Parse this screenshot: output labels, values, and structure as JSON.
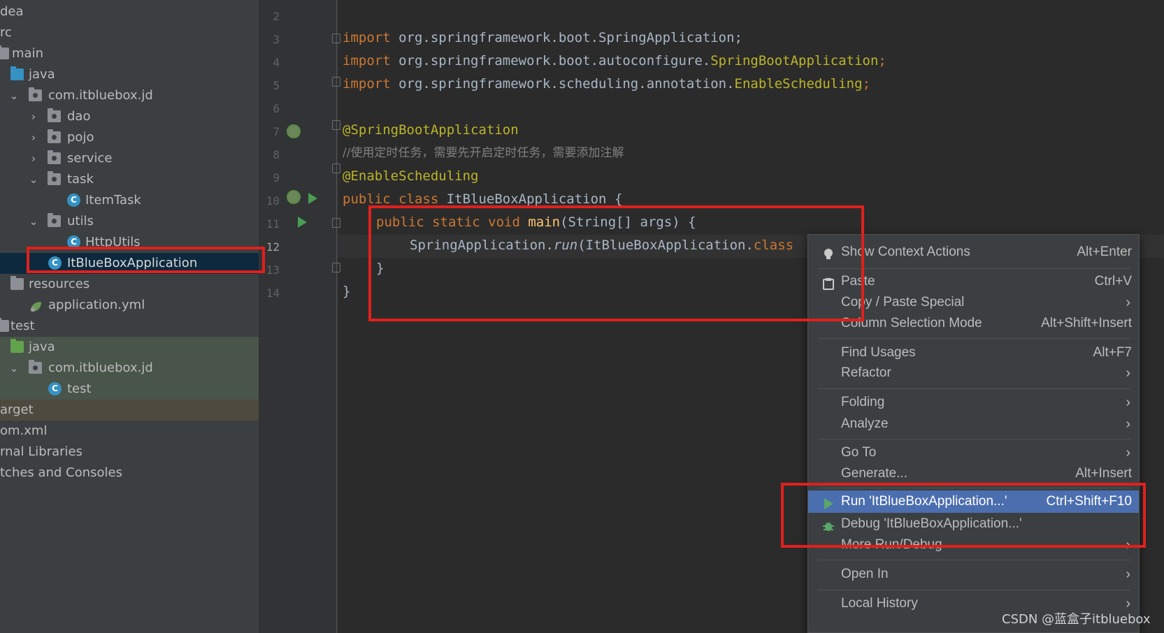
{
  "project_tree": {
    "items": [
      {
        "label": "dea",
        "depth": 0,
        "chevron": "",
        "icon": "",
        "style": ""
      },
      {
        "label": "rc",
        "depth": 0,
        "chevron": "",
        "icon": "",
        "style": ""
      },
      {
        "label": "main",
        "depth": 0,
        "chevron": "",
        "icon": "folder",
        "style": ""
      },
      {
        "label": "java",
        "depth": 1,
        "chevron": "",
        "icon": "folder-blue",
        "style": ""
      },
      {
        "label": "com.itbluebox.jd",
        "depth": 1,
        "chevron": "v",
        "icon": "package",
        "style": ""
      },
      {
        "label": "dao",
        "depth": 2,
        "chevron": ">",
        "icon": "package",
        "style": ""
      },
      {
        "label": "pojo",
        "depth": 2,
        "chevron": ">",
        "icon": "package",
        "style": ""
      },
      {
        "label": "service",
        "depth": 2,
        "chevron": ">",
        "icon": "package",
        "style": ""
      },
      {
        "label": "task",
        "depth": 2,
        "chevron": "v",
        "icon": "package",
        "style": ""
      },
      {
        "label": "ItemTask",
        "depth": 3,
        "chevron": "",
        "icon": "class",
        "style": ""
      },
      {
        "label": "utils",
        "depth": 2,
        "chevron": "v",
        "icon": "package",
        "style": ""
      },
      {
        "label": "HttpUtils",
        "depth": 3,
        "chevron": "",
        "icon": "class",
        "style": ""
      },
      {
        "label": "ItBlueBoxApplication",
        "depth": 2,
        "chevron": "",
        "icon": "spring-class",
        "style": "selected"
      },
      {
        "label": "resources",
        "depth": 0,
        "chevron": "",
        "icon": "folder",
        "style": ""
      },
      {
        "label": "application.yml",
        "depth": 1,
        "chevron": "",
        "icon": "spring-leaf",
        "style": ""
      },
      {
        "label": "test",
        "depth": 0,
        "chevron": "",
        "icon": "",
        "style": ""
      },
      {
        "label": "java",
        "depth": 1,
        "chevron": "",
        "icon": "folder-green",
        "style": "test"
      },
      {
        "label": "com.itbluebox.jd",
        "depth": 1,
        "chevron": "v",
        "icon": "package",
        "style": "test"
      },
      {
        "label": "test",
        "depth": 2,
        "chevron": "",
        "icon": "class",
        "style": "test"
      },
      {
        "label": "arget",
        "depth": 0,
        "chevron": "",
        "icon": "",
        "style": "target"
      },
      {
        "label": "om.xml",
        "depth": 0,
        "chevron": "",
        "icon": "",
        "style": ""
      },
      {
        "label": "rnal Libraries",
        "depth": 0,
        "chevron": "",
        "icon": "",
        "style": ""
      },
      {
        "label": "tches and Consoles",
        "depth": 0,
        "chevron": "",
        "icon": "",
        "style": ""
      }
    ]
  },
  "editor": {
    "line_numbers": [
      "2",
      "3",
      "4",
      "5",
      "6",
      "7",
      "8",
      "9",
      "10",
      "11",
      "12",
      "13",
      "14"
    ],
    "lines": {
      "l3": {
        "kw": "import",
        "rest": " org.springframework.boot.SpringApplication;"
      },
      "l4": {
        "kw": "import",
        "pkg": " org.springframework.boot.autoconfigure.",
        "cls": "SpringBootApplication",
        "semi": ";"
      },
      "l5": {
        "kw": "import",
        "pkg": " org.springframework.scheduling.annotation.",
        "cls": "EnableScheduling",
        "semi": ";"
      },
      "l7": "@SpringBootApplication",
      "l8": "//使用定时任务，需要先开启定时任务，需要添加注解",
      "l9": "@EnableScheduling",
      "l10": {
        "kw": "public class",
        "rest": " ItBlueBoxApplication {"
      },
      "l11": {
        "kw": "public static void",
        "fn": " main",
        "rest": "(String[] args) {"
      },
      "l12": {
        "pre": "SpringApplication.",
        "it": "run",
        "rest": "(ItBlueBoxApplication.",
        "kw": "class"
      },
      "l13": "}",
      "l14": "}"
    }
  },
  "context_menu": {
    "items": [
      {
        "label": "Show Context Actions",
        "shortcut": "Alt+Enter",
        "submenu": false,
        "icon": "lightbulb-icon"
      },
      {
        "label": "Paste",
        "shortcut": "Ctrl+V",
        "submenu": false,
        "icon": "clipboard-icon"
      },
      {
        "label": "Copy / Paste Special",
        "shortcut": "",
        "submenu": true,
        "icon": ""
      },
      {
        "label": "Column Selection Mode",
        "shortcut": "Alt+Shift+Insert",
        "submenu": false,
        "icon": ""
      },
      {
        "label": "Find Usages",
        "shortcut": "Alt+F7",
        "submenu": false,
        "icon": ""
      },
      {
        "label": "Refactor",
        "shortcut": "",
        "submenu": true,
        "icon": ""
      },
      {
        "label": "Folding",
        "shortcut": "",
        "submenu": true,
        "icon": ""
      },
      {
        "label": "Analyze",
        "shortcut": "",
        "submenu": true,
        "icon": ""
      },
      {
        "label": "Go To",
        "shortcut": "",
        "submenu": true,
        "icon": ""
      },
      {
        "label": "Generate...",
        "shortcut": "Alt+Insert",
        "submenu": false,
        "icon": ""
      },
      {
        "label": "Run 'ItBlueBoxApplication...'",
        "shortcut": "Ctrl+Shift+F10",
        "submenu": false,
        "icon": "run-icon",
        "highlighted": true
      },
      {
        "label": "Debug 'ItBlueBoxApplication...'",
        "shortcut": "",
        "submenu": false,
        "icon": "debug-icon"
      },
      {
        "label": "More Run/Debug",
        "shortcut": "",
        "submenu": true,
        "icon": ""
      },
      {
        "label": "Open In",
        "shortcut": "",
        "submenu": true,
        "icon": ""
      },
      {
        "label": "Local History",
        "shortcut": "",
        "submenu": true,
        "icon": ""
      }
    ]
  },
  "watermark": "CSDN @蓝盒子itbluebox",
  "colors": {
    "annotation_red": "#e0201c",
    "highlight": "#4b6eaf",
    "run_green": "#499c54"
  }
}
